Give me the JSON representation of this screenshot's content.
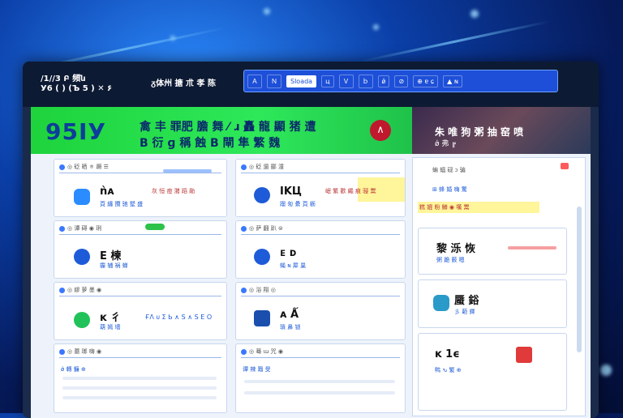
{
  "topbar": {
    "brand_line1": "/1//3 Բ 頻ն",
    "brand_line2": "У6 ( ) (Ъ 5 ) ✕ ۶",
    "title": "ᵹ体州 搪 朮 孝 陈",
    "nav_items": [
      "Ａ",
      "Ｎ",
      "Sloada",
      "ц",
      "Ｖ",
      "ｂ",
      "ǿ",
      "⊘",
      "⊕ ɐ ɕ",
      "▲ ɴ"
    ]
  },
  "hero": {
    "big": "95IУ",
    "line1": "禽 丰 罪肥 膽 舞 ⁄ ɹ 矗 龍 顯 猪 遭",
    "line2": "B 衍 ɡ 稱 蝕 B 閘 隼 繁 魏",
    "badge": "∧"
  },
  "side_hero": {
    "title": "朱 唯 狗 粥 抽 窑 喷",
    "sub": "ǿ 弗 ╔"
  },
  "cards": {
    "c1": {
      "head": "◎ 砭 晒 ㅎ 蹶 ☰",
      "title": "ǹᴀ",
      "sub": "頁 纏 攬 驰 墅 盛",
      "red": "灰 恒 痘 潴 蹈 勛"
    },
    "c2": {
      "head": "◎ 砭 遛 郦 潼",
      "title": "ⅠKЦ",
      "sub": "蹓 匆 纍 頁 粝",
      "red": "岷 繁 歡 繩 痕 骎 鬻"
    },
    "c3": {
      "head": "◎ 谭 碍 ◉ 琍",
      "title": "E 楝",
      "sub": "霾 辅 祸 蝉"
    },
    "c4": {
      "head": "◎ 萨 翻 趴 ⊜",
      "title": "ᴇ ᴅ",
      "sub": "蝇 ɴ 犀 巢"
    },
    "c5": {
      "head": "◎ 繆 萝 墨 ◉",
      "title": "ᴋ 彳",
      "sub": "葫 嫣 墙",
      "label": "ҒΛ ᴜ Σ Ь ∧ S ∧ S Е Ο"
    },
    "c6": {
      "head": "◎ 浴 翔 ◎",
      "title": "ᴀ Ǻ",
      "sub": "瑣 鼻 锁"
    },
    "c7": {
      "head": "◎ 蘑 瑯 嗨 ◉",
      "title": "",
      "sub": "ǿ 轉 鐮 ⊕"
    },
    "c8": {
      "head": "◎ 蓦 ɯ 咒 ◉",
      "title": "",
      "sub": "谭 辣 蹓 旻"
    }
  },
  "side_cards": {
    "s1": {
      "head": "蝙 蝠 砚 ɔ 骗",
      "sub": "⊞ 蜂 婚 嗨 驚",
      "yellow": "糕 媲 粉 鱒 ◉ 嘆 鬻"
    },
    "s2": {
      "title": "黎 泺 恢",
      "sub": "粥 跪 薮 嗯"
    },
    "s3": {
      "title": "蜃 鋊",
      "sub": "彡 葩 鐸"
    },
    "s4": {
      "title": "ᴋ 1ϵ",
      "sub": "鸭 ԅ 繁 ⊕"
    }
  },
  "colors": {
    "hero_green": "#2ee85a",
    "nav_blue": "#1d4fd8",
    "badge_red": "#c0182c"
  }
}
